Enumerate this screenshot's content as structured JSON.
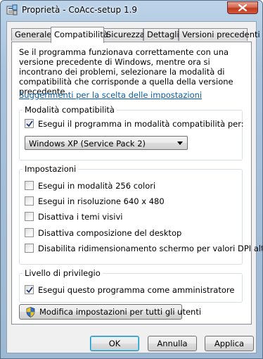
{
  "window": {
    "title": "Proprietà - CoAcc-setup 1.9"
  },
  "tabs": [
    {
      "label": "Generale"
    },
    {
      "label": "Compatibilità"
    },
    {
      "label": "Sicurezza"
    },
    {
      "label": "Dettagli"
    },
    {
      "label": "Versioni precedenti"
    }
  ],
  "active_tab": "Compatibilità",
  "intro": "Se il programma funzionava correttamente con una versione precedente di Windows, mentre ora si incontrano dei problemi, selezionare la modalità di compatibilità che corrisponde a quella della versione precedente.",
  "help_link": "Suggerimenti per la scelta delle impostazioni",
  "compat_group": {
    "legend": "Modalità compatibilità",
    "checkbox_label": "Esegui il programma in modalità compatibilità per:",
    "checked": true,
    "os_selected": "Windows XP (Service Pack 2)"
  },
  "settings_group": {
    "legend": "Impostazioni",
    "options": [
      {
        "label": "Esegui in modalità 256 colori",
        "checked": false
      },
      {
        "label": "Esegui in risoluzione 640 x 480",
        "checked": false
      },
      {
        "label": "Disattiva i temi visivi",
        "checked": false
      },
      {
        "label": "Disattiva composizione del desktop",
        "checked": false
      },
      {
        "label": "Disabilita ridimensionamento schermo per valori DPI alti",
        "checked": false
      }
    ]
  },
  "privilege_group": {
    "legend": "Livello di privilegio",
    "checkbox_label": "Esegui questo programma come amministratore",
    "checked": true
  },
  "all_users_button": "Modifica impostazioni per tutti gli utenti",
  "footer": {
    "ok": "OK",
    "cancel": "Annulla",
    "apply": "Applica"
  },
  "colors": {
    "link": "#0b5ea4",
    "default_button_border": "#3c7fb1",
    "close_button": "#c0391f"
  }
}
